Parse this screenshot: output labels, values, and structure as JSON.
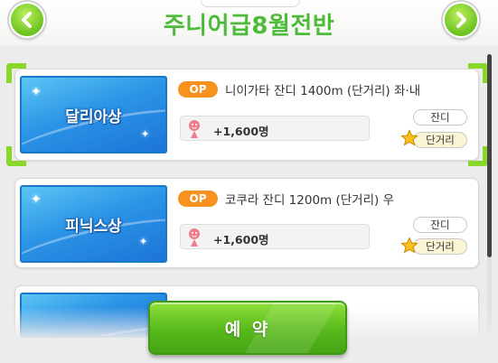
{
  "header": {
    "title": "주니어급8월전반"
  },
  "races": [
    {
      "banner_name": "달리아상",
      "badge": "OP",
      "title": "니이가타 잔디 1400m (단거리) 좌·내",
      "fans": "+1,600명",
      "surface": "잔디",
      "distance": "단거리",
      "selected": true
    },
    {
      "banner_name": "피닉스상",
      "badge": "OP",
      "title": "코쿠라 잔디 1200m (단거리) 우",
      "fans": "+1,600명",
      "surface": "잔디",
      "distance": "단거리",
      "selected": false
    }
  ],
  "buttons": {
    "reserve_label": "예 약"
  },
  "colors": {
    "accent_green": "#4dbb3a",
    "badge_orange": "#f7921e",
    "banner_blue": "#2c95e6"
  },
  "icons": {
    "prev": "chevron-left-icon",
    "next": "chevron-right-icon",
    "fans": "fan-person-icon",
    "distance": "star-icon"
  }
}
